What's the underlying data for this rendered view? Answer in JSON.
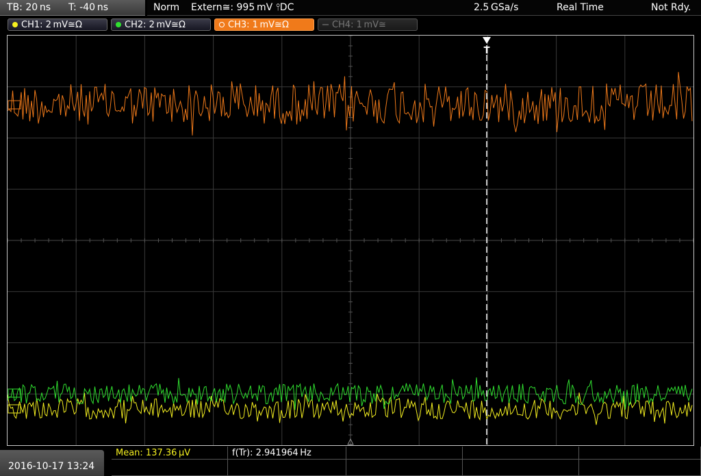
{
  "header": {
    "timebase": "TB: 20 ns",
    "trigger_time": "T: -40 ns",
    "mode": "Norm",
    "trigger_info": "Extern≅: 995 mV ⫯DC",
    "sample_rate": "2.5 GSa/s",
    "acq_mode": "Real Time",
    "status": "Not Rdy."
  },
  "channels": [
    {
      "label": "CH1: 2 mV≅Ω",
      "color": "#f5f020",
      "active": true
    },
    {
      "label": "CH2: 2 mV≅Ω",
      "color": "#30e030",
      "active": true
    },
    {
      "label": "CH3: 1 mV≅Ω",
      "color": "#f07a1a",
      "active": true,
      "selected": true
    },
    {
      "label": "CH4: 1 mV≅",
      "color": "#666666",
      "active": false
    }
  ],
  "trigger_marker": "T",
  "footer": {
    "datetime": "2016-10-17 13:24",
    "mean_label": "Mean: 137.36 µV",
    "freq_label": "f(Tr): 2.941964 Hz"
  },
  "colors": {
    "ch1": "#f5f020",
    "ch2": "#30e030",
    "ch3": "#f07a1a",
    "grid": "#3a3a3a"
  }
}
